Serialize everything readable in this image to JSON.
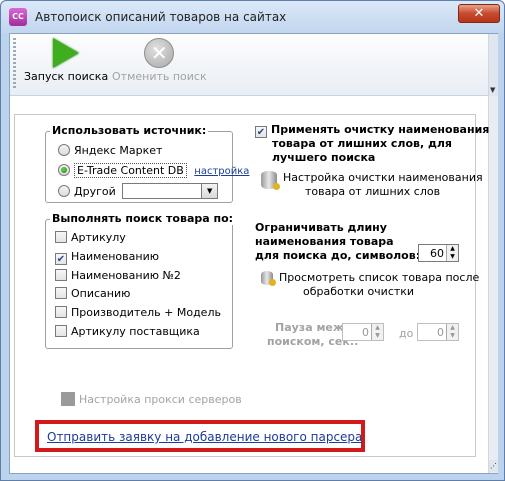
{
  "window": {
    "icon_text": "CC",
    "title": "Автопоиск описаний товаров на сайтах",
    "close": "✕"
  },
  "toolbar": {
    "start_label": "Запуск поиска",
    "cancel_label": "Отменить поиск"
  },
  "sources": {
    "title": "Использовать источник:",
    "options": [
      {
        "label": "Яндекс Маркет",
        "selected": false
      },
      {
        "label": "E-Trade Content DB",
        "selected": true
      },
      {
        "label": "Другой",
        "selected": false
      }
    ],
    "settings_link": "настройка"
  },
  "search_by": {
    "title": "Выполнять поиск товара по:",
    "options": [
      {
        "label": "Артикулу",
        "checked": false
      },
      {
        "label": "Наименованию",
        "checked": true
      },
      {
        "label": "Наименованию №2",
        "checked": false
      },
      {
        "label": "Описанию",
        "checked": false
      },
      {
        "label": "Производитель + Модель",
        "checked": false
      },
      {
        "label": "Артикулу поставщика",
        "checked": false
      }
    ]
  },
  "cleanup": {
    "apply_label_1": "Применять очистку наименования",
    "apply_label_2": "товара от лишних слов, для",
    "apply_label_3": "лучшего поиска",
    "settings_1": "Настройка очистки наименования",
    "settings_2": "товара от лишних слов"
  },
  "limit": {
    "label_1": "Ограничивать длину",
    "label_2": "наименования товара",
    "label_3": "для поиска до, символов:",
    "value": "60",
    "preview_1": "Просмотреть список товара после",
    "preview_2": "обработки очистки"
  },
  "pause": {
    "label_1": "Пауза между",
    "label_2": "поиском, сек.:",
    "from": "0",
    "to_label": "до",
    "to": "0"
  },
  "proxy_label": "Настройка прокси серверов",
  "parser_link": "Отправить заявку на добавление нового парсера",
  "colors": {
    "accent": "#1a3d9a",
    "highlight": "#d31a1a",
    "play": "#3fae1e"
  }
}
